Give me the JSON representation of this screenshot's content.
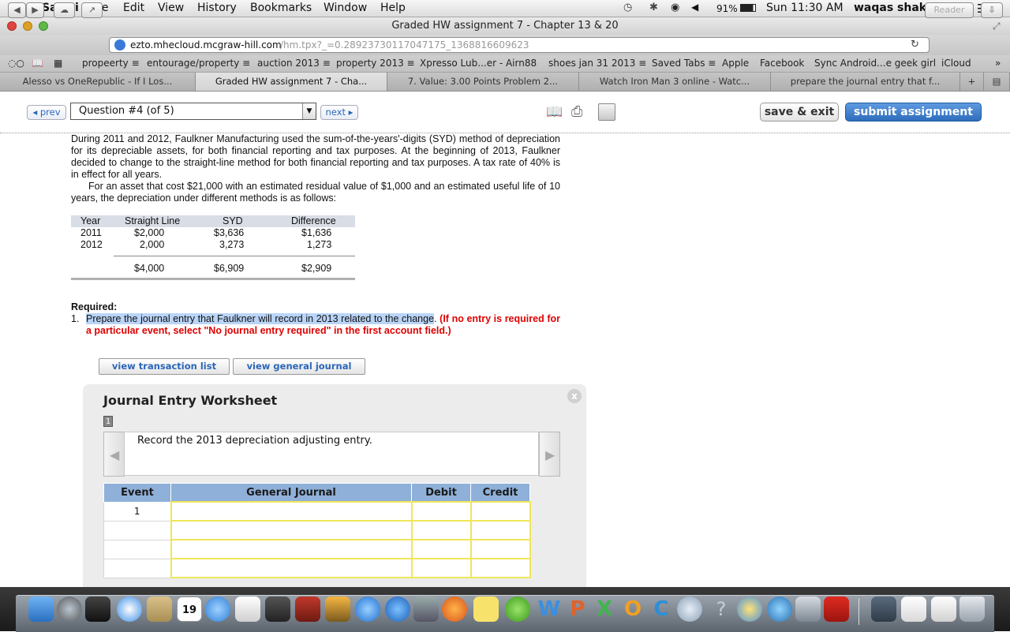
{
  "menubar": {
    "app_name": "Safari",
    "menus": [
      "File",
      "Edit",
      "View",
      "History",
      "Bookmarks",
      "Window",
      "Help"
    ],
    "battery": "91%",
    "clock": "Sun 11:30 AM",
    "user": "waqas shakeel"
  },
  "window": {
    "title": "Graded HW assignment 7 - Chapter 13 & 20",
    "url_domain": "ezto.mhecloud.mcgraw-hill.com",
    "url_path": "/hm.tpx?_=0.28923730117047175_1368816609623",
    "reader_label": "Reader"
  },
  "bookmarks": [
    "propeerty ≡",
    "entourage/property ≡",
    "auction 2013 ≡",
    "property 2013 ≡",
    "Xpresso Lub...er - Airn88",
    "shoes jan 31 2013 ≡",
    "Saved Tabs ≡",
    "Apple",
    "Facebook",
    "Sync Android...e geek girl",
    "iCloud"
  ],
  "tabs": [
    {
      "label": "Alesso vs OneRepublic - If I Los...",
      "active": false
    },
    {
      "label": "Graded HW assignment 7 - Cha...",
      "active": true
    },
    {
      "label": "7. Value: 3.00 Points Problem 2...",
      "active": false
    },
    {
      "label": "Watch Iron Man 3 online - Watc...",
      "active": false
    },
    {
      "label": "prepare the journal entry that f...",
      "active": false
    }
  ],
  "nav": {
    "prev": "◂ prev",
    "question": "Question #4 (of 5)",
    "next": "next ▸",
    "save_exit": "save & exit",
    "submit": "submit assignment"
  },
  "problem": {
    "para1": "During 2011 and 2012, Faulkner Manufacturing used the sum-of-the-years'-digits (SYD) method of depreciation for its depreciable assets, for both financial reporting and tax purposes. At the beginning of 2013, Faulkner decided to change to the straight-line method for both financial reporting and tax purposes. A tax rate of 40% is in effect for all years.",
    "para2": "For an asset that cost $21,000 with an estimated residual value of $1,000 and an estimated useful life of 10 years, the depreciation under different methods is as follows:"
  },
  "dep_table": {
    "headers": [
      "Year",
      "Straight Line",
      "SYD",
      "Difference"
    ],
    "rows": [
      [
        "2011",
        "$2,000",
        "$3,636",
        "$1,636"
      ],
      [
        "2012",
        "2,000",
        "3,273",
        "1,273"
      ]
    ],
    "totals": [
      "$4,000",
      "$6,909",
      "$2,909"
    ]
  },
  "required": {
    "heading": "Required:",
    "number": "1.",
    "instruction": "Prepare the journal entry that Faulkner will record in 2013 related to the change",
    "period": ".",
    "note": "(If no entry is required for a particular event, select \"No journal entry required\" in the first account field.)"
  },
  "buttons": {
    "view_transactions": "view transaction list",
    "view_journal": "view general journal"
  },
  "worksheet": {
    "title": "Journal Entry Worksheet",
    "step": "1",
    "close": "x",
    "description": "Record the 2013 depreciation adjusting entry.",
    "columns": [
      "Event",
      "General Journal",
      "Debit",
      "Credit"
    ],
    "first_event": "1"
  }
}
